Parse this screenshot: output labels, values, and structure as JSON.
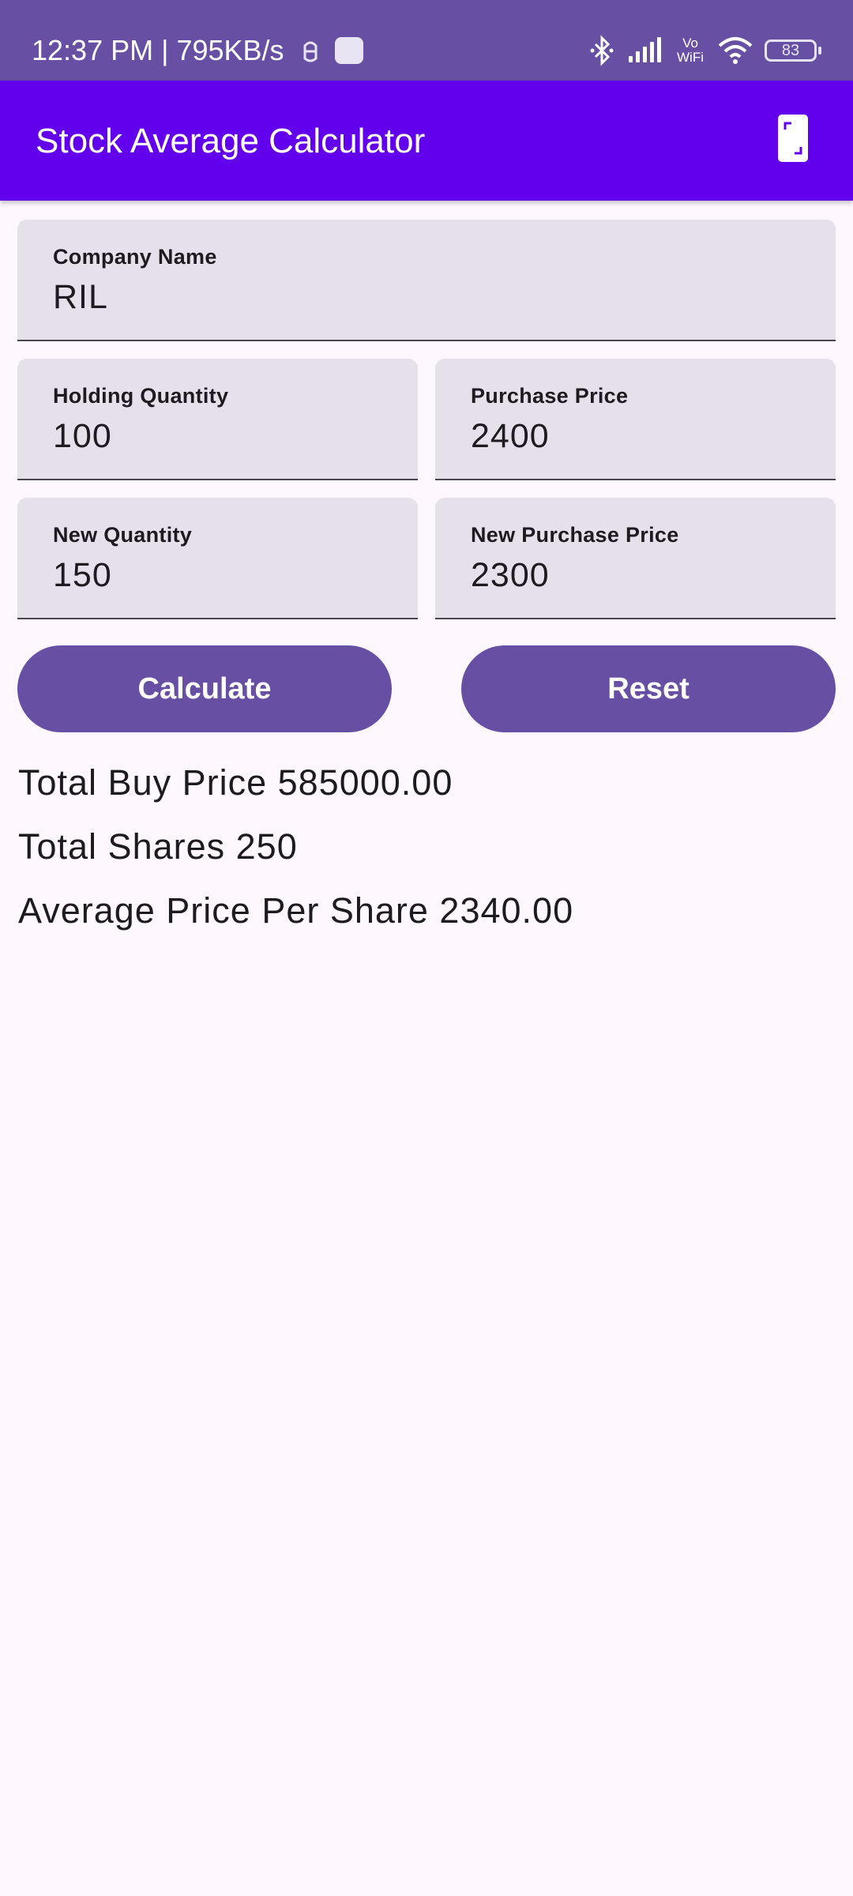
{
  "status_bar": {
    "time": "12:37 PM | 795KB/s",
    "vowifi_top": "Vo",
    "vowifi_bottom": "WiFi",
    "battery_level": "83",
    "icons": [
      "notification-icon",
      "app-icon",
      "bluetooth-icon",
      "signal-icon",
      "vowifi-icon",
      "wifi-icon",
      "battery-icon"
    ]
  },
  "app_bar": {
    "title": "Stock Average Calculator",
    "action_icon": "screen-icon"
  },
  "form": {
    "company_name": {
      "label": "Company Name",
      "value": "RIL"
    },
    "holding_quantity": {
      "label": "Holding Quantity",
      "value": "100"
    },
    "purchase_price": {
      "label": "Purchase Price",
      "value": "2400"
    },
    "new_quantity": {
      "label": "New Quantity",
      "value": "150"
    },
    "new_purchase_price": {
      "label": "New Purchase Price",
      "value": "2300"
    }
  },
  "buttons": {
    "calculate_label": "Calculate",
    "reset_label": "Reset"
  },
  "results": {
    "total_buy_price": "Total Buy Price 585000.00",
    "total_shares": "Total Shares 250",
    "average_price": "Average Price Per Share 2340.00"
  },
  "colors": {
    "status_bar": "#6750a4",
    "app_bar": "#6200ee",
    "button": "#6750a4",
    "field_background": "#e6e0eb",
    "page_background": "#fef7fd"
  }
}
